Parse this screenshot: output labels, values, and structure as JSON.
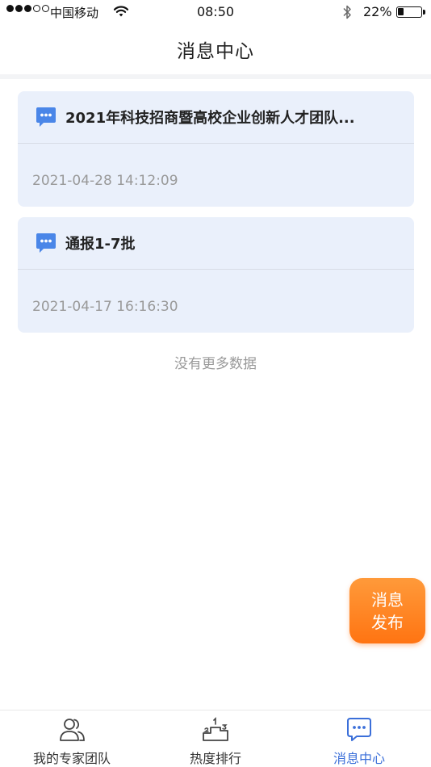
{
  "status_bar": {
    "carrier": "中国移动",
    "time": "08:50",
    "battery": "22%"
  },
  "header": {
    "title": "消息中心"
  },
  "messages": [
    {
      "title": "2021年科技招商暨高校企业创新人才团队...",
      "time": "2021-04-28  14:12:09"
    },
    {
      "title": "通报1-7批",
      "time": "2021-04-17  16:16:30"
    }
  ],
  "list_footer": "没有更多数据",
  "fab": {
    "line1": "消息",
    "line2": "发布"
  },
  "tabbar": {
    "items": [
      {
        "label": "我的专家团队",
        "icon": "team-icon"
      },
      {
        "label": "热度排行",
        "icon": "ranking-icon"
      },
      {
        "label": "消息中心",
        "icon": "message-icon"
      }
    ]
  },
  "colors": {
    "accent": "#3b6fd9",
    "card_bg": "#eaf0fb",
    "fab": "#ff7a18"
  }
}
